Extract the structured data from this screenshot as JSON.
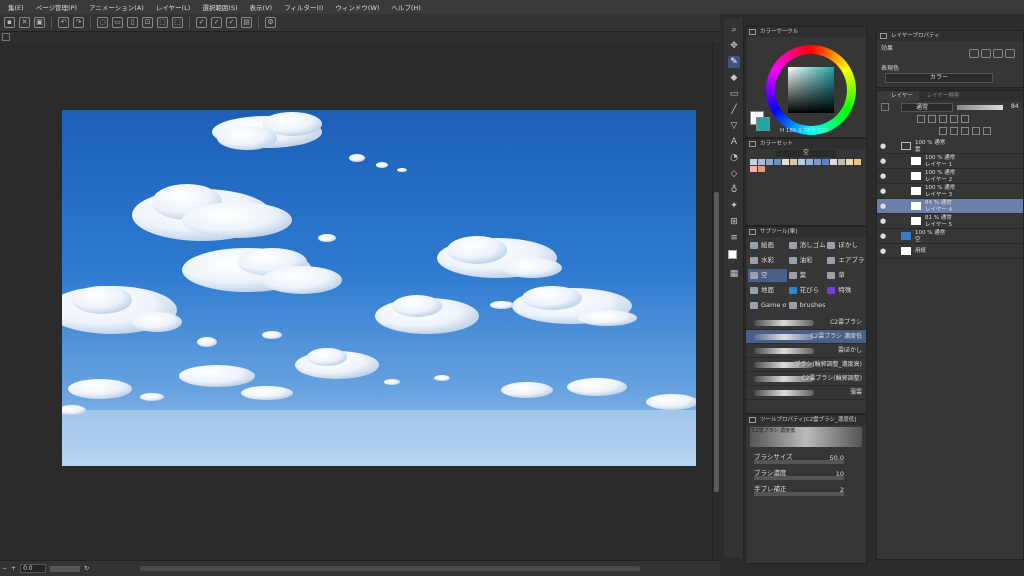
{
  "menu": [
    "集(E)",
    "ページ管理(P)",
    "アニメーション(A)",
    "レイヤー(L)",
    "選択範囲(S)",
    "表示(V)",
    "フィルター(I)",
    "ウィンドウ(W)",
    "ヘルプ(H)"
  ],
  "color_panel": {
    "title": "カラーサークル",
    "readout": "H 180 S 78 V 100",
    "main_color": "#1fa5a3",
    "sub_color": "#ffffff"
  },
  "color_set": {
    "title": "カラーセット",
    "set_name": "空",
    "colors": [
      "#c7d3e6",
      "#a9bcd9",
      "#8ca5cc",
      "#6f8ebf",
      "#e9e0d0",
      "#d9c8a8",
      "#b5cbe4",
      "#97b3d7",
      "#7a9bca",
      "#5d83bd",
      "#dcdcdc",
      "#bdbdbd",
      "#f2d7b0",
      "#e9c48f",
      "#f3b2a6",
      "#e9967f"
    ]
  },
  "subtool_panel": {
    "title": "サブツール[筆]",
    "items": [
      "絵画",
      "消しゴム",
      "ぼかし",
      "水彩",
      "油彩",
      "エアブラシ",
      "空",
      "葉",
      "草",
      "地面",
      "花びら",
      "特殊",
      "Game of",
      "brushes"
    ],
    "active": "空"
  },
  "brush_list": [
    "C2雲ブラシ",
    "C2雲ブラシ 濃度低",
    "雲ぼかし",
    "ブラシ(輪郭調整_濃度高)",
    "C2雲ブラシ(輪郭調整)",
    "薄雲"
  ],
  "tool_property": {
    "title": "ツールプロパティ[C2雲ブラシ_濃度低]",
    "preview_label": "C2雲ブラシ 濃度低",
    "size_label": "ブラシサイズ",
    "size_value": "50.0",
    "density_label": "ブラシ濃度",
    "density_value": "10",
    "stabilize_label": "手ブレ補正",
    "stabilize_value": "2"
  },
  "layer_property": {
    "title": "レイヤープロパティ",
    "effect_label": "効果",
    "expression_label": "表現色",
    "expression_value": "カラー"
  },
  "layers": {
    "tab_layer": "レイヤー",
    "tab_search": "レイヤー検索",
    "blend_mode": "通常",
    "opacity": "84",
    "items": [
      {
        "meta": "100 % 通常",
        "name": "雲",
        "folder": true,
        "selected": false
      },
      {
        "meta": "100 % 通常",
        "name": "レイヤー 1",
        "folder": false,
        "selected": false
      },
      {
        "meta": "100 % 通常",
        "name": "レイヤー 2",
        "folder": false,
        "selected": false
      },
      {
        "meta": "100 % 通常",
        "name": "レイヤー 3",
        "folder": false,
        "selected": false
      },
      {
        "meta": "84 % 通常",
        "name": "レイヤー 4",
        "folder": false,
        "selected": true
      },
      {
        "meta": "81 % 通常",
        "name": "レイヤー 5",
        "folder": false,
        "selected": false
      },
      {
        "meta": "100 % 通常",
        "name": "空",
        "folder": false,
        "selected": false
      },
      {
        "meta": "",
        "name": "用紙",
        "folder": false,
        "selected": false
      }
    ]
  },
  "status": {
    "zoom": "0.0"
  }
}
